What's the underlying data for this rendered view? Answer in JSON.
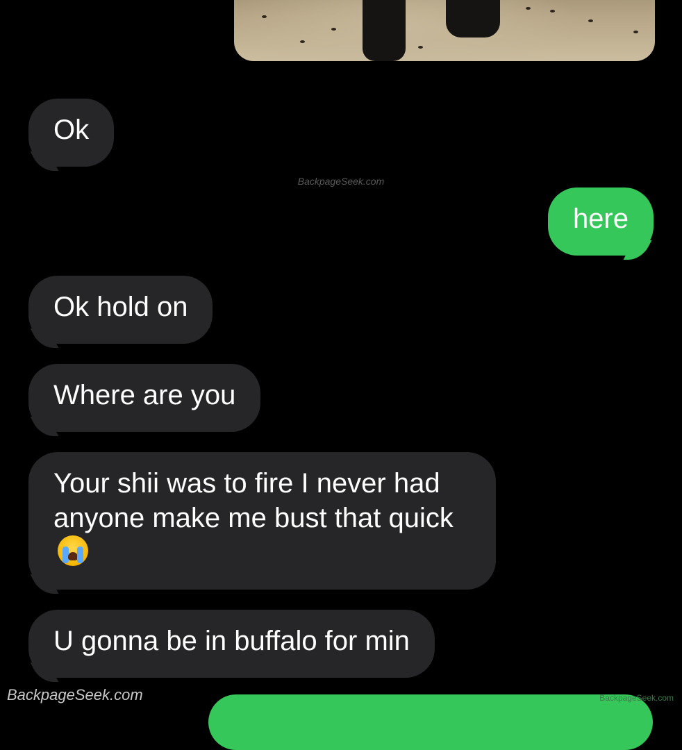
{
  "conversation": {
    "watermark_center": "BackpageSeek.com",
    "watermark_bottom_left": "BackpageSeek.com",
    "watermark_bottom_right": "BackpageSeek.com",
    "messages": [
      {
        "direction": "incoming",
        "text": "Ok"
      },
      {
        "direction": "outgoing",
        "text": "here"
      },
      {
        "direction": "incoming",
        "text": "Ok hold on"
      },
      {
        "direction": "incoming",
        "text": "Where are you"
      },
      {
        "direction": "incoming",
        "text": "Your shii was to fire I never had anyone make me bust that quick",
        "emoji": "loudly-crying-face"
      },
      {
        "direction": "incoming",
        "text": "U gonna be in buffalo for min"
      }
    ]
  },
  "colors": {
    "background": "#000000",
    "incoming_bubble": "#262628",
    "outgoing_bubble": "#35c759",
    "text": "#ffffff"
  }
}
